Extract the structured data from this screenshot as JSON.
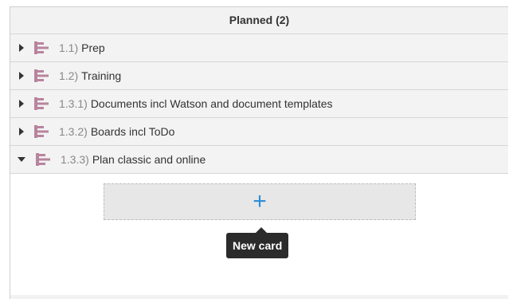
{
  "panel": {
    "title": "Planned (2)"
  },
  "rows": [
    {
      "num": "1.1)",
      "title": "Prep",
      "expanded": false,
      "icon": "epic-icon"
    },
    {
      "num": "1.2)",
      "title": "Training",
      "expanded": false,
      "icon": "epic-icon"
    },
    {
      "num": "1.3.1)",
      "title": "Documents incl Watson and document templates",
      "expanded": false,
      "icon": "epic-icon"
    },
    {
      "num": "1.3.2)",
      "title": "Boards incl ToDo",
      "expanded": false,
      "icon": "epic-icon"
    },
    {
      "num": "1.3.3)",
      "title": "Plan classic and online",
      "expanded": true,
      "icon": "epic-icon"
    }
  ],
  "add_card": {
    "icon": "plus-icon",
    "tooltip": "New card"
  },
  "colors": {
    "epic_icon": "#b8849e",
    "plus": "#2e8fd6",
    "tooltip_bg": "#2b2b2b"
  }
}
